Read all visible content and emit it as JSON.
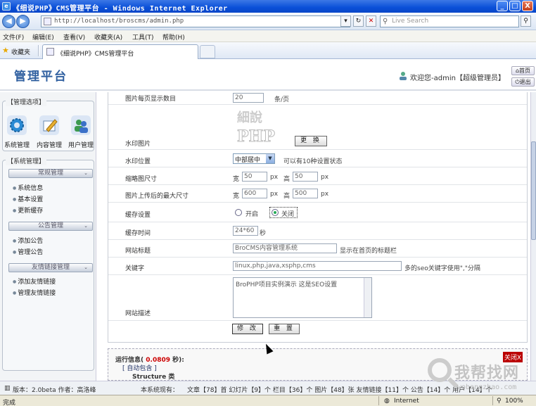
{
  "window": {
    "title": "《细说PHP》CMS管理平台 - Windows Internet Explorer",
    "min": "_",
    "max": "□",
    "close": "X"
  },
  "browser": {
    "back": "◀",
    "forward": "▶",
    "url": "http://localhost/broscms/admin.php",
    "search_placeholder": "Live Search",
    "menu": [
      "文件(F)",
      "编辑(E)",
      "查看(V)",
      "收藏夹(A)",
      "工具(T)",
      "帮助(H)"
    ],
    "favorites_label": "收藏夹",
    "tab_title": "《细说PHP》CMS管理平台"
  },
  "header": {
    "logo": "管理平台",
    "welcome": "欢迎您-admin【超级管理员】",
    "home_btn": "首页",
    "logout_btn": "退出"
  },
  "sidebar": {
    "options_legend": "【管理选项】",
    "quick": [
      "系统管理",
      "内容管理",
      "用户管理"
    ],
    "system_legend": "【系统管理】",
    "groups": [
      {
        "title": "常规管理",
        "items": [
          "系统信息",
          "基本设置",
          "更新缓存"
        ]
      },
      {
        "title": "公告管理",
        "items": [
          "添加公告",
          "管理公告"
        ]
      },
      {
        "title": "友情链接管理",
        "items": [
          "添加友情链接",
          "管理友情链接"
        ]
      }
    ]
  },
  "form": {
    "per_page_label": "图片每页显示数目",
    "per_page_value": "20",
    "per_page_unit": "条/页",
    "watermark_label": "水印图片",
    "watermark_img_text": "PHP",
    "change_btn": "更 换",
    "wm_pos_label": "水印位置",
    "wm_pos_value": "中部居中",
    "wm_pos_note": "可以有10种设置状态",
    "thumb_label": "缩略图尺寸",
    "width_label": "宽",
    "height_label": "高",
    "px": "px",
    "thumb_w": "50",
    "thumb_h": "50",
    "maxsize_label": "图片上传后的最大尺寸",
    "max_w": "600",
    "max_h": "500",
    "cache_label": "缓存设置",
    "cache_on": "开启",
    "cache_off": "关闭",
    "cache_time_label": "缓存时间",
    "cache_time_value": "24*60",
    "cache_time_unit": "秒",
    "site_title_label": "网站标题",
    "site_title_value": "BroCMS内容管理系统",
    "site_title_note": "显示在首页的标题栏",
    "keywords_label": "关键字",
    "keywords_value": "linux,php,java,xsphp,cms",
    "keywords_note": "多的seo关键字使用\",\"分隔",
    "desc_label": "网站描述",
    "desc_value": "BroPHP项目实例演示 这是SEO设置",
    "submit_btn": "修 改",
    "reset_btn": "重 置"
  },
  "runinfo": {
    "label": "运行信息(",
    "time": "0.0809",
    "unit": "秒):",
    "autoload": "[ 自动包含 ]",
    "structure": "Structure 类",
    "close": "关闭X"
  },
  "footer": {
    "version": "版本：2.0beta  作者：高洛峰",
    "stats_label": "本系统现有：",
    "stats": "文章【78】首   幻灯片【9】个  栏目【36】个   图片【48】张   友情链接【11】个  公告【14】个  用户【14】个"
  },
  "status": {
    "left": "完成",
    "zone": "Internet",
    "zoom": "100%"
  },
  "brand": {
    "name": "我帮找网",
    "domain": "wobangzhao.com"
  }
}
